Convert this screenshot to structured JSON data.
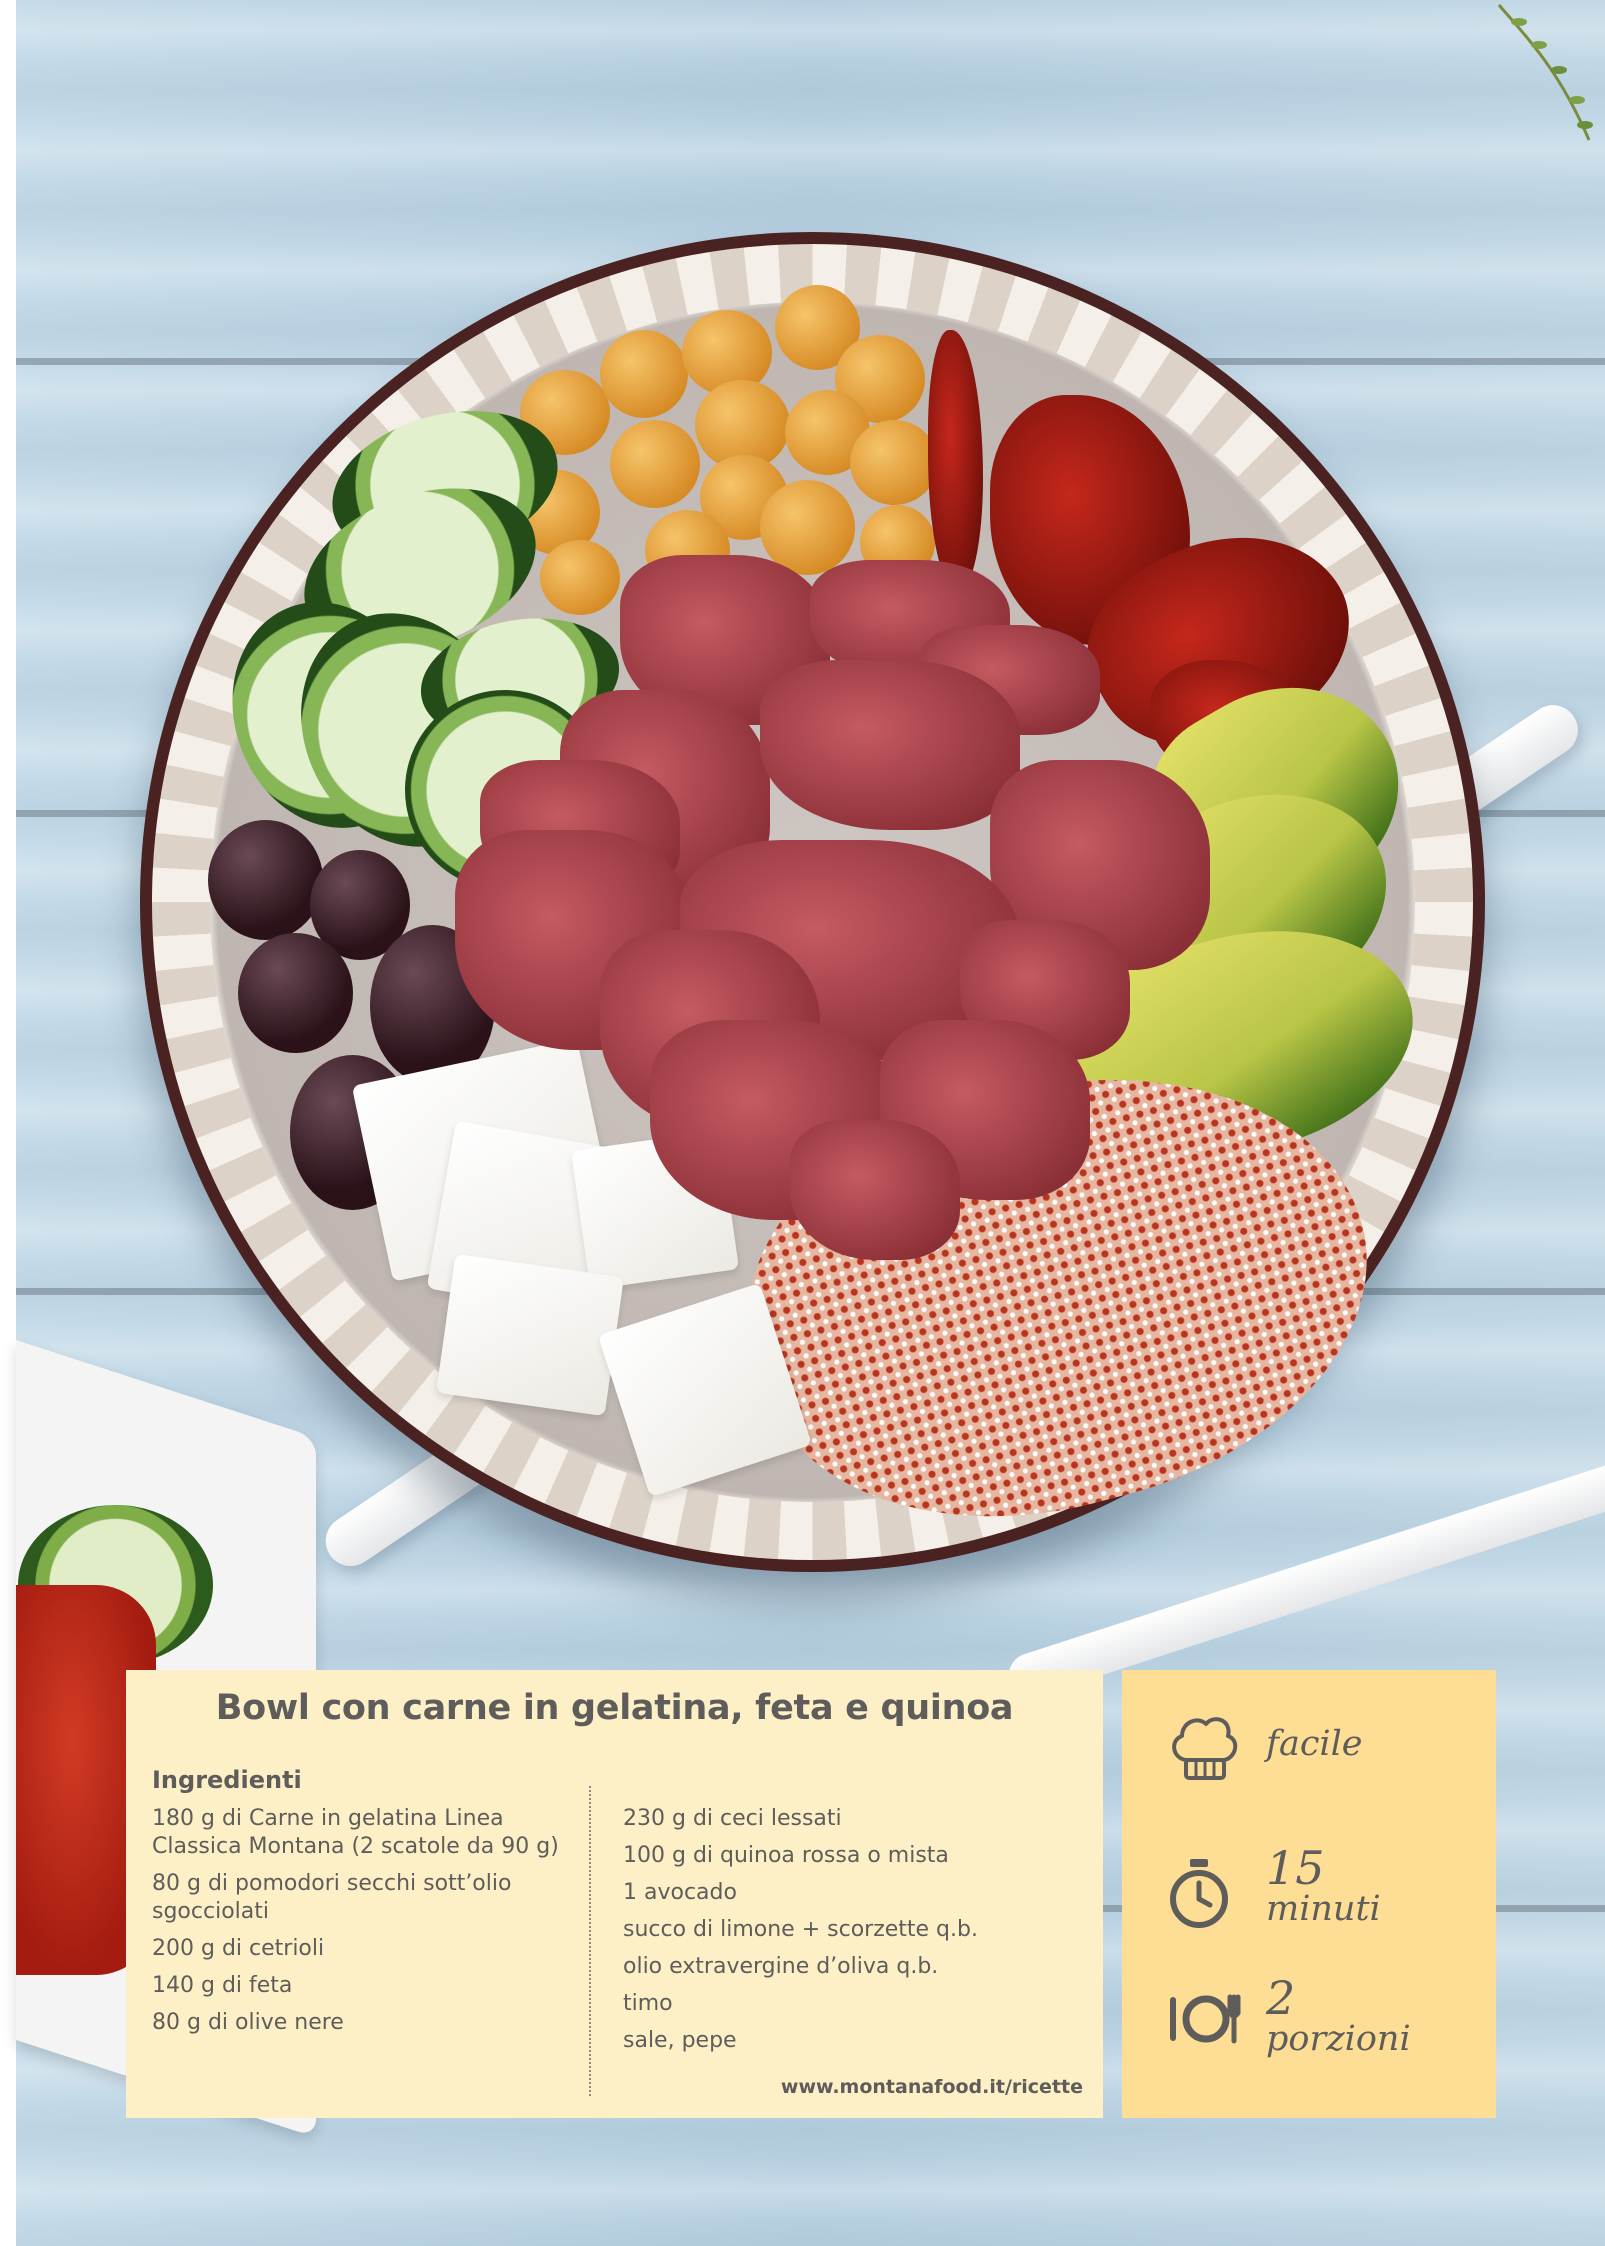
{
  "recipe": {
    "title": "Bowl con carne in gelatina, feta e quinoa",
    "ingredients_heading": "Ingredienti",
    "ingredients_left": [
      "180 g di Carne in gelatina Linea Classica Montana (2 scatole da 90 g)",
      "80 g di pomodori secchi sott’olio sgocciolati",
      "200 g di cetrioli",
      "140 g di feta",
      "80 g di olive nere"
    ],
    "ingredients_right": [
      "230 g di ceci lessati",
      "100 g di quinoa rossa o mista",
      "1 avocado",
      "succo di limone + scorzette q.b.",
      "olio extravergine d’oliva q.b.",
      "timo",
      "sale, pepe"
    ],
    "website": "www.montanafood.it/ricette"
  },
  "info": {
    "difficulty": "facile",
    "time_value": "15",
    "time_unit": "minuti",
    "servings_value": "2",
    "servings_unit": "porzioni",
    "icons": [
      "chef-hat-icon",
      "stopwatch-icon",
      "plate-cutlery-icon"
    ]
  },
  "colors": {
    "card_background": "#fdf0c6",
    "info_background": "#fedd95",
    "text": "#5f5d5b",
    "wood_background": "#b9d2e2"
  }
}
